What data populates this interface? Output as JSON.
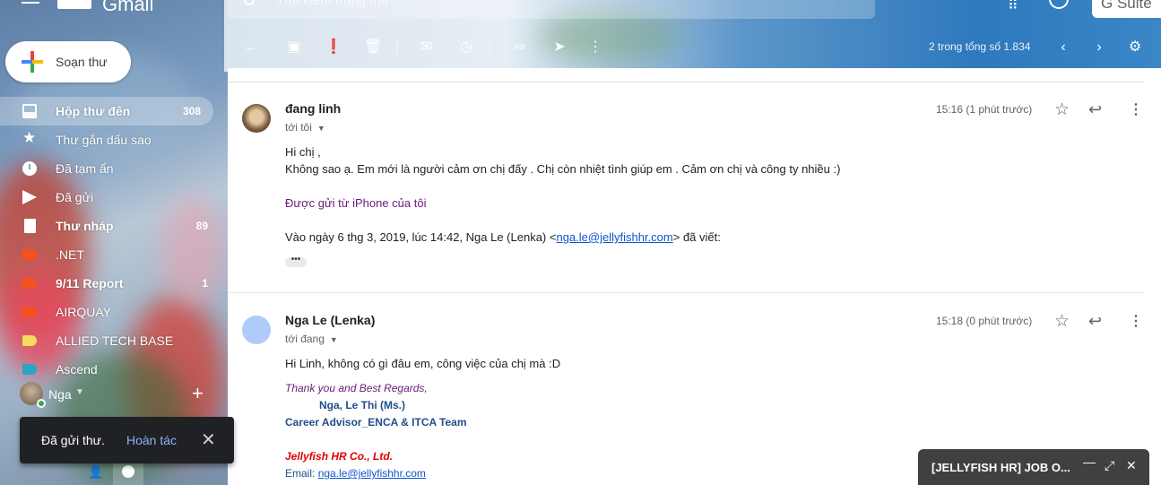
{
  "app": {
    "logo_text": "Gmail",
    "search_placeholder": "Tìm kiếm trong thư",
    "suite_button": "G Suite"
  },
  "sidebar": {
    "compose_label": "Soạn thư",
    "items": [
      {
        "label": "Hộp thư đến",
        "count": "308",
        "icon": "inbox-icon"
      },
      {
        "label": "Thư gắn dấu sao",
        "count": "",
        "icon": "star-icon"
      },
      {
        "label": "Đã tạm ẩn",
        "count": "",
        "icon": "clock-icon"
      },
      {
        "label": "Đã gửi",
        "count": "",
        "icon": "send-icon"
      },
      {
        "label": "Thư nháp",
        "count": "89",
        "icon": "draft-icon"
      },
      {
        "label": ".NET",
        "count": "",
        "icon": "label-icon",
        "color": "#f4511e"
      },
      {
        "label": "9/11 Report",
        "count": "1",
        "icon": "label-icon",
        "color": "#f4511e"
      },
      {
        "label": "AIRQUAY",
        "count": "",
        "icon": "label-icon",
        "color": "#f4511e"
      },
      {
        "label": "ALLIED TECH BASE",
        "count": "",
        "icon": "label-icon",
        "color": "#f6dc5c"
      },
      {
        "label": "Ascend",
        "count": "",
        "icon": "label-icon",
        "color": "#2aa5c0"
      }
    ],
    "account_name": "Nga"
  },
  "toast": {
    "message": "Đã gửi thư.",
    "undo": "Hoàn tác"
  },
  "toolbar": {
    "pager": "2 trong tổng số 1.834"
  },
  "messages": [
    {
      "sender": "đang linh",
      "to": "tới tôi",
      "time": "15:16 (1 phút trước)",
      "lines": [
        "Hi chị ,",
        "Không sao ạ. Em mới là người cảm ơn chị đấy . Chị còn nhiệt tình giúp em . Cảm ơn chị và công ty nhiều :)",
        "Được gửi từ iPhone của tôi",
        "Vào ngày 6 thg 3, 2019, lúc 14:42, Nga Le (Lenka) <",
        "nga.le@jellyfishhr.com",
        "> đã viết:"
      ]
    },
    {
      "sender": "Nga Le (Lenka)",
      "to": "tới đang",
      "time": "15:18 (0 phút trước)",
      "lines": [
        "Hi Linh, không có gì đâu em, công việc của chị mà :D",
        "Thank you and Best Regards,",
        "Nga, Le Thi (Ms.)",
        "Career Advisor_ENCA & ITCA Team",
        "Jellyfish HR Co., Ltd.",
        "Email: ",
        "nga.le@jellyfishhr.com"
      ]
    }
  ],
  "popup": {
    "title": "[JELLYFISH HR] JOB O..."
  }
}
